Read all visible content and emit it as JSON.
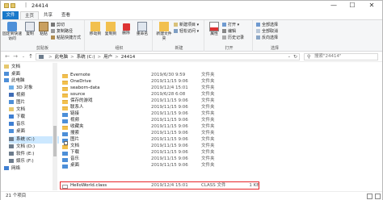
{
  "window": {
    "title_sep": "|",
    "title": "24414",
    "minimize": "—",
    "maximize": "☐",
    "close": "✕"
  },
  "tabs": [
    {
      "label": "文件"
    },
    {
      "label": "主页"
    },
    {
      "label": "共享"
    },
    {
      "label": "查看"
    }
  ],
  "ribbon": {
    "pin_label": "固定到快速访问",
    "copy_label": "复制",
    "paste_label": "粘贴",
    "cut_label": "剪切",
    "copy_path_label": "复制路径",
    "paste_shortcut_label": "粘贴快捷方式",
    "move_to_label": "移动到",
    "copy_to_label": "复制到",
    "delete_label": "删除",
    "rename_label": "重命名",
    "new_folder_label": "新建文件夹",
    "new_item_label": "新建项目 ▾",
    "easy_access_label": "轻松访问 ▾",
    "properties_label": "属性",
    "open_label": "打开 ▾",
    "edit_label": "编辑",
    "history_label": "历史记录",
    "select_all_label": "全部选择",
    "select_none_label": "全部取消",
    "invert_select_label": "反向选择",
    "group_clipboard": "剪贴板",
    "group_organize": "组织",
    "group_new": "新建",
    "group_open": "打开",
    "group_select": "选择"
  },
  "address": {
    "back": "←",
    "forward": "→",
    "up_history": "⌄",
    "up": "↑",
    "crumbs": [
      "此电脑",
      "系统 (C:)",
      "用户",
      "24414"
    ],
    "crumb_sep": ">",
    "dropdown": "⌄",
    "refresh": "↻",
    "search_placeholder": "搜索\"24414\"",
    "search_icon": "⚲"
  },
  "nav": [
    {
      "label": "文档",
      "icon": "document-icon",
      "color": "#e6c86e"
    },
    {
      "label": "桌面",
      "icon": "desktop-icon",
      "color": "#4d8fd8"
    },
    {
      "label": "此电脑",
      "icon": "computer-icon",
      "color": "#4d8fd8"
    },
    {
      "label": "3D 对象",
      "icon": "3d-objects-icon",
      "color": "#6fb0e8"
    },
    {
      "label": "视频",
      "icon": "video-icon",
      "color": "#3f6cb5"
    },
    {
      "label": "图片",
      "icon": "pictures-icon",
      "color": "#4d8fd8"
    },
    {
      "label": "文档",
      "icon": "documents-icon",
      "color": "#e6c86e"
    },
    {
      "label": "下载",
      "icon": "download-icon",
      "color": "#3f7fd2"
    },
    {
      "label": "音乐",
      "icon": "music-icon",
      "color": "#3f7fd2"
    },
    {
      "label": "桌面",
      "icon": "desktop-icon",
      "color": "#4d8fd8"
    },
    {
      "label": "系统 (C:)",
      "icon": "drive-icon",
      "color": "#6d7c8c"
    },
    {
      "label": "文档 (D:)",
      "icon": "drive-icon",
      "color": "#6d7c8c"
    },
    {
      "label": "软件 (E:)",
      "icon": "drive-icon",
      "color": "#6d7c8c"
    },
    {
      "label": "娱乐 (F:)",
      "icon": "drive-icon",
      "color": "#6d7c8c"
    },
    {
      "label": "网络",
      "icon": "network-icon",
      "color": "#3f7fd2"
    }
  ],
  "files": [
    {
      "name": "Evernote",
      "date": "2019/6/30 9:59",
      "type": "文件夹",
      "size": "",
      "icon": "folder-icon",
      "kind": "folder"
    },
    {
      "name": "OneDrive",
      "date": "2019/11/15 9:06",
      "type": "文件夹",
      "size": "",
      "icon": "folder-icon",
      "kind": "folder"
    },
    {
      "name": "seaborn-data",
      "date": "2019/12/4 15:01",
      "type": "文件夹",
      "size": "",
      "icon": "folder-icon",
      "kind": "folder"
    },
    {
      "name": "source",
      "date": "2019/6/28 6:08",
      "type": "文件夹",
      "size": "",
      "icon": "folder-icon",
      "kind": "folder"
    },
    {
      "name": "保存的游戏",
      "date": "2019/11/15 9:06",
      "type": "文件夹",
      "size": "",
      "icon": "saved-games-icon",
      "kind": "folder"
    },
    {
      "name": "联系人",
      "date": "2019/11/15 9:06",
      "type": "文件夹",
      "size": "",
      "icon": "contacts-icon",
      "kind": "folder"
    },
    {
      "name": "链接",
      "date": "2019/11/15 9:06",
      "type": "文件夹",
      "size": "",
      "icon": "links-icon",
      "kind": "blue"
    },
    {
      "name": "视频",
      "date": "2019/11/15 9:06",
      "type": "文件夹",
      "size": "",
      "icon": "videos-icon",
      "kind": "blue"
    },
    {
      "name": "收藏夹",
      "date": "2019/11/15 9:06",
      "type": "文件夹",
      "size": "",
      "icon": "favorites-icon",
      "kind": "folder"
    },
    {
      "name": "搜索",
      "date": "2019/11/15 9:06",
      "type": "文件夹",
      "size": "",
      "icon": "search-folder-icon",
      "kind": "blue"
    },
    {
      "name": "图片",
      "date": "2019/11/15 9:06",
      "type": "文件夹",
      "size": "",
      "icon": "pictures-icon",
      "kind": "blue"
    },
    {
      "name": "文档",
      "date": "2019/11/15 9:06",
      "type": "文件夹",
      "size": "",
      "icon": "documents-icon",
      "kind": "folder"
    },
    {
      "name": "下载",
      "date": "2019/11/15 9:06",
      "type": "文件夹",
      "size": "",
      "icon": "downloads-icon",
      "kind": "blue"
    },
    {
      "name": "音乐",
      "date": "2019/11/15 9:06",
      "type": "文件夹",
      "size": "",
      "icon": "music-icon",
      "kind": "blue"
    },
    {
      "name": "桌面",
      "date": "2019/11/15 9:06",
      "type": "文件夹",
      "size": "",
      "icon": "desktop-icon",
      "kind": "blue"
    },
    {
      "name": "HelloWorld.class",
      "date": "2019/12/4 15:01",
      "type": "CLASS 文件",
      "size": "1 KB",
      "icon": "file-icon",
      "kind": "doc"
    }
  ],
  "status": {
    "count": "21 个项目"
  },
  "colors": {
    "accent": "#1979ca",
    "selection": "#cce8ff",
    "highlight": "#e8262a"
  }
}
